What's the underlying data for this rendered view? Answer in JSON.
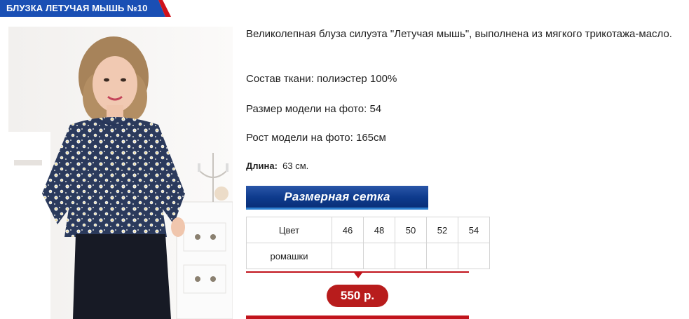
{
  "header": {
    "title": "БЛУЗКА ЛЕТУЧАЯ МЫШЬ №10",
    "bar_color": "#1a4fb4",
    "accent_color": "#d0111a"
  },
  "product": {
    "description": "Великолепная блуза силуэта \"Летучая мышь\", выполнена из мягкого трикотажа-масло.",
    "fabric": "Состав ткани: полиэстер 100%",
    "model_size": "Размер модели на фото: 54",
    "model_height": "Рост модели на фото: 165см",
    "length_label": "Длина:",
    "length_value": "63 см."
  },
  "size_chart_button": "Размерная сетка",
  "size_table": {
    "header": [
      "Цвет",
      "46",
      "48",
      "50",
      "52",
      "54"
    ],
    "rows": [
      [
        "ромашки",
        "",
        "",
        "",
        "",
        ""
      ]
    ]
  },
  "price": "550 р.",
  "colors": {
    "price": "#b81c1c",
    "button": "#0d3a8c"
  }
}
